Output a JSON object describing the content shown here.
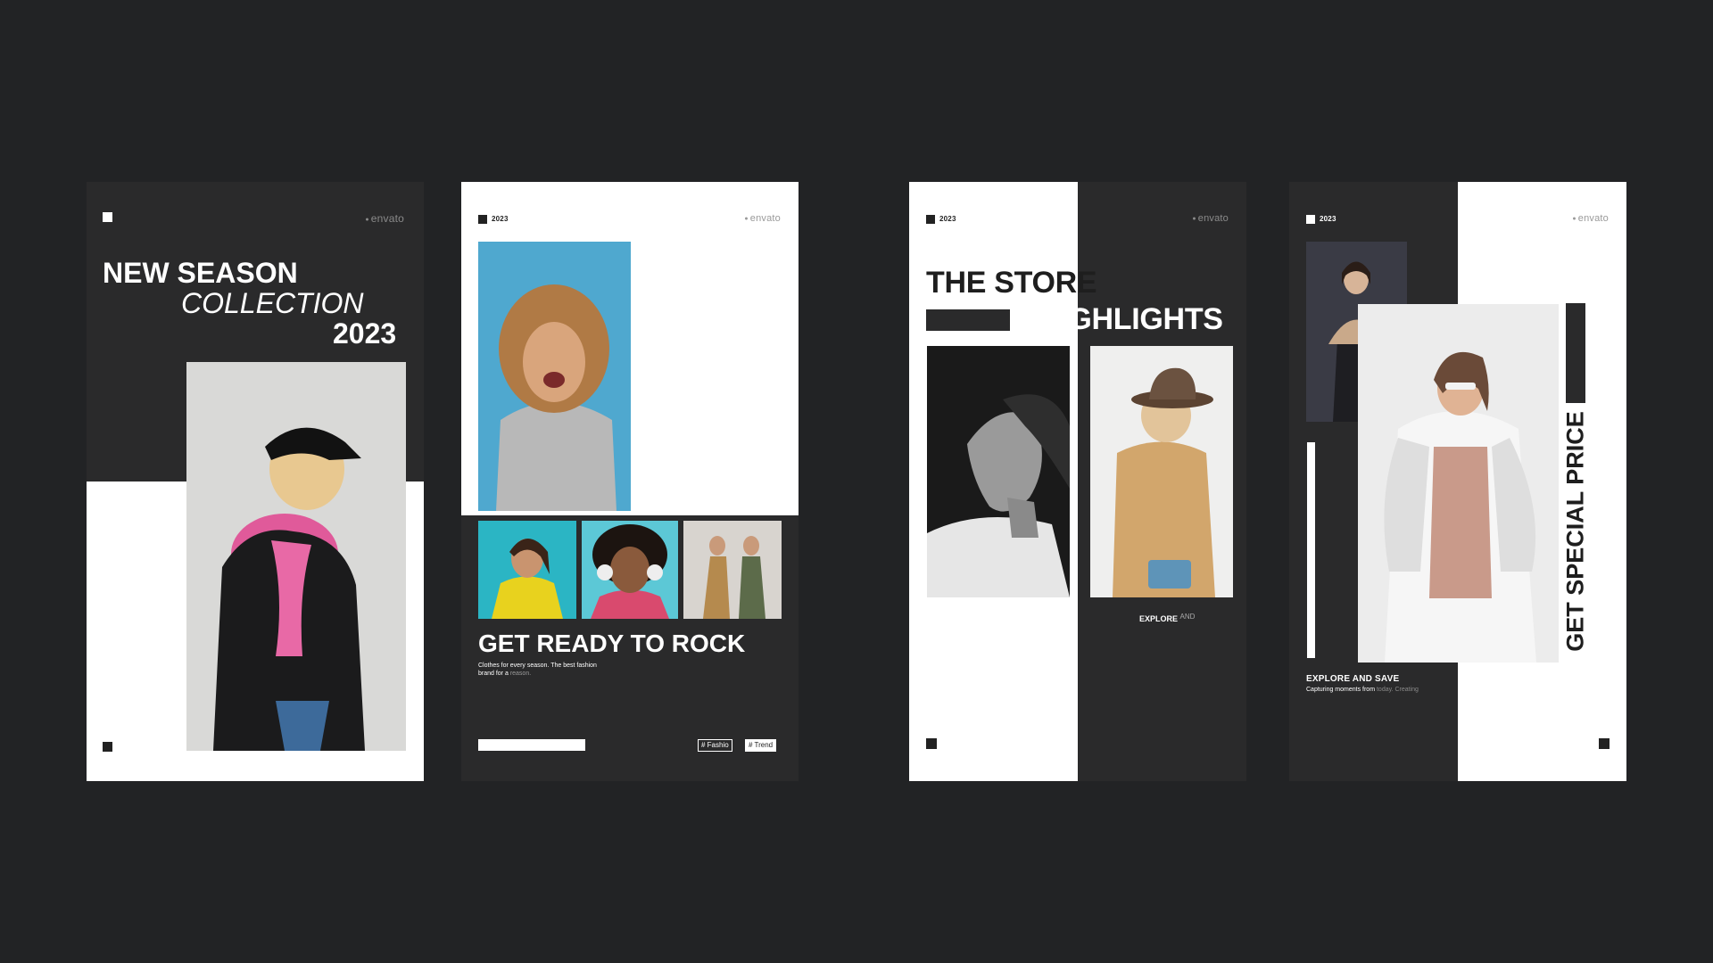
{
  "cards": [
    {
      "brand": "envato",
      "headline_line1": "NEW SEASON",
      "headline_line2": "COLLECTION",
      "headline_line3": "2023"
    },
    {
      "year": "2023",
      "brand": "envato",
      "headline": "GET READY TO ROCK",
      "body_line1": "Clothes for every season. The best fashion",
      "body_line2": "brand for a ",
      "body_line2_faded": "reason.",
      "tags": [
        "# Fashio",
        "# Trend"
      ]
    },
    {
      "year": "2023",
      "brand": "envato",
      "headline_line1": "THE STORE",
      "headline_line2": "HIGHLIGHTS",
      "caption": "EXPLORE",
      "caption_faded": "AND"
    },
    {
      "year": "2023",
      "brand": "envato",
      "vertical_headline": "GET SPECIAL PRICE",
      "caption": "EXPLORE AND SAVE",
      "sub_line": "Capturing moments from ",
      "sub_line_faded": "today. Creating"
    }
  ],
  "colors": {
    "background": "#222325",
    "panel_dark": "#2a2a2b",
    "panel_light": "#ffffff"
  }
}
